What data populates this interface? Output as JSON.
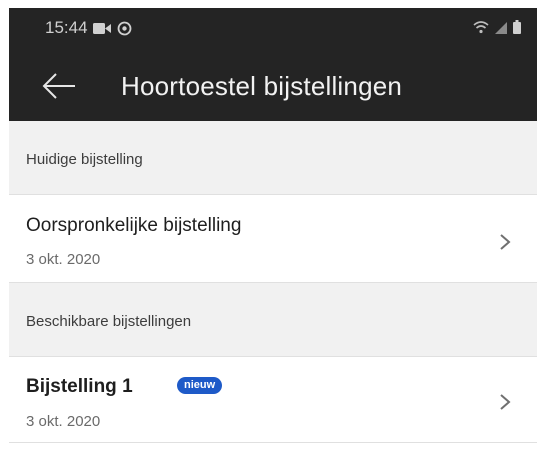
{
  "status_bar": {
    "time": "15:44",
    "icons_left": [
      "video-call-icon",
      "sync-icon"
    ],
    "icons_right": [
      "wifi-icon",
      "signal-icon",
      "battery-icon"
    ]
  },
  "app_bar": {
    "title": "Hoortoestel bijstellingen",
    "back_icon": "back-arrow-icon"
  },
  "sections": {
    "current": {
      "header": "Huidige bijstelling",
      "item": {
        "title": "Oorspronkelijke bijstelling",
        "date": "3 okt. 2020"
      }
    },
    "available": {
      "header": "Beschikbare bijstellingen",
      "item": {
        "title": "Bijstelling 1",
        "badge": "nieuw",
        "date": "3 okt. 2020"
      }
    }
  },
  "colors": {
    "app_bar_bg": "#242424",
    "section_bg": "#f1f1f1",
    "badge_bg": "#1e5ac8"
  }
}
